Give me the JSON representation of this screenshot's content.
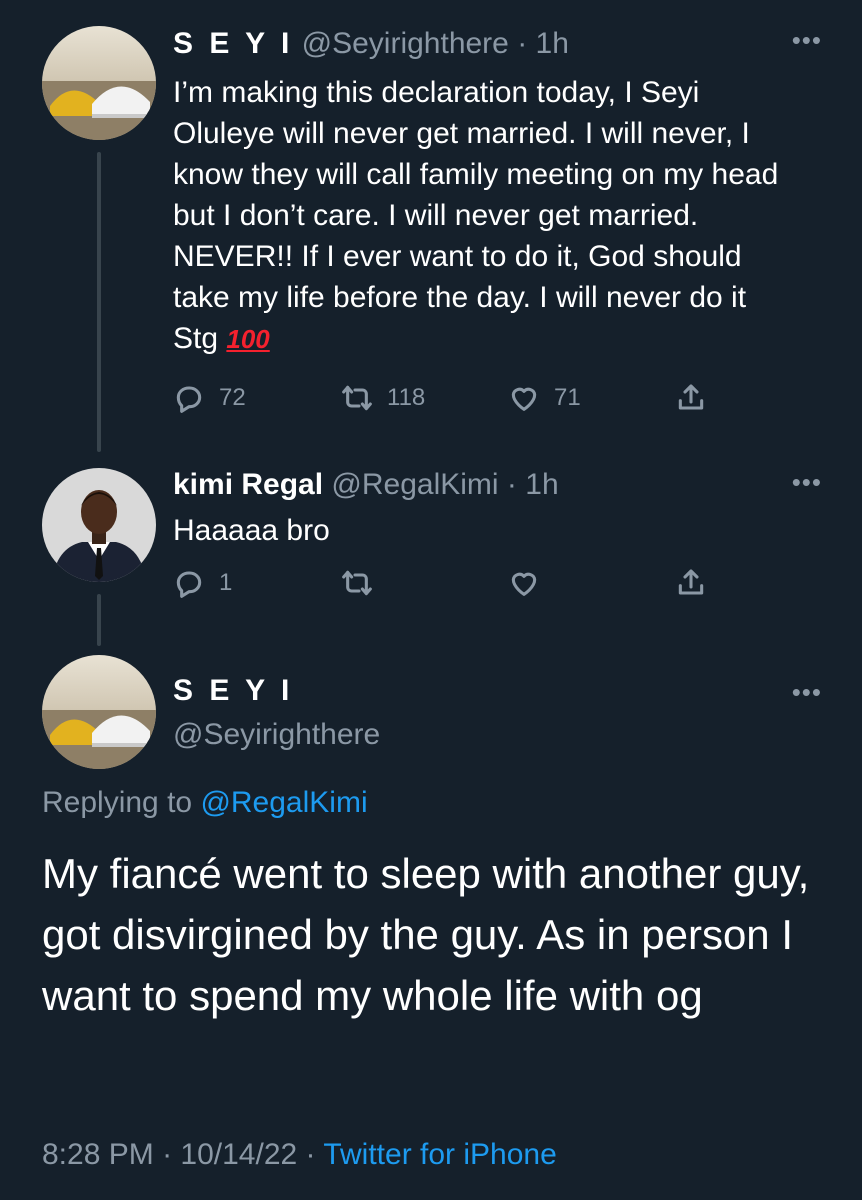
{
  "reply1": {
    "name": "S E Y I",
    "handle": "@Seyirighthere",
    "separator": "·",
    "time": "1h",
    "text": "I’m making this declaration today, I Seyi Oluleye will never get married. I will never, I know they will call family meeting on my head but I don’t care. I will never get married. NEVER!! If I ever want to do it, God should take my life before the day. I will never do it Stg",
    "emoji": "💯",
    "emoji_text": "100",
    "replies": "72",
    "retweets": "118",
    "likes": "71"
  },
  "reply2": {
    "name": "kimi Regal",
    "handle": "@RegalKimi",
    "separator": "·",
    "time": "1h",
    "text": "Haaaaa bro",
    "replies": "1",
    "retweets": "",
    "likes": ""
  },
  "main": {
    "name": "S E Y I",
    "handle": "@Seyirighthere",
    "replying_prefix": "Replying to ",
    "replying_to": "@RegalKimi",
    "text": "My fiancé went to sleep with another guy, got disvirgined by the guy. As in person I want to spend my whole life with og",
    "time": "8:28 PM",
    "separator": "·",
    "date": "10/14/22",
    "source": "Twitter for iPhone"
  },
  "icons": {
    "reply": "reply-icon",
    "retweet": "retweet-icon",
    "like": "heart-icon",
    "share": "share-icon",
    "more": "more-icon"
  },
  "colors": {
    "background": "#15202b",
    "text": "#ffffff",
    "secondary": "#8b98a5",
    "link": "#1d9bf0"
  }
}
